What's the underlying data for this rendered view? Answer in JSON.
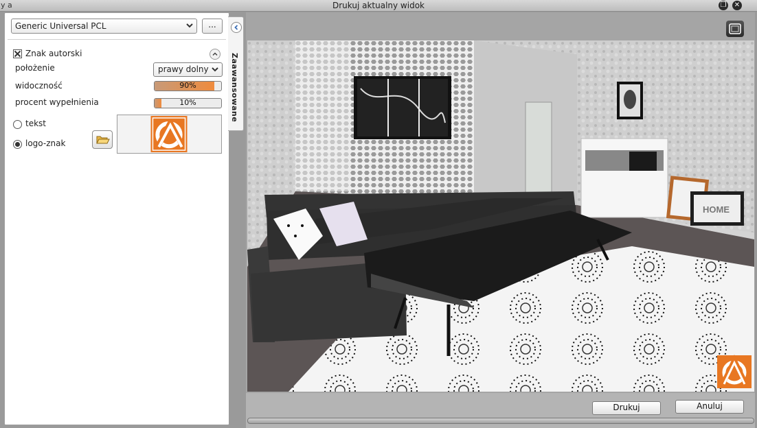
{
  "window": {
    "title": "Drukuj aktualny widok",
    "background_fragment": "y a",
    "restore_glyph": "❐",
    "close_glyph": "✕"
  },
  "printer": {
    "selected": "Generic Universal PCL",
    "more_label": "..."
  },
  "watermark_section": {
    "checkbox_label": "Znak autorski",
    "checked": true,
    "position_label": "położenie",
    "position_value": "prawy dolny",
    "visibility_label": "widoczność",
    "visibility_value": "90%",
    "visibility_fraction": 0.9,
    "fill_label": "procent wypełnienia",
    "fill_value": "10%",
    "fill_fraction": 0.1,
    "option_text_label": "tekst",
    "option_logo_label": "logo-znak",
    "selected_option": "logo-znak"
  },
  "side_tab": {
    "label": "Zaawansowane"
  },
  "preview": {
    "watermark_logo_color": "#e87722",
    "wall_art_label": "HOME"
  },
  "actions": {
    "print_label": "Drukuj",
    "cancel_label": "Anuluj"
  },
  "colors": {
    "accent": "#ef8b3d",
    "logo": "#e87722"
  }
}
